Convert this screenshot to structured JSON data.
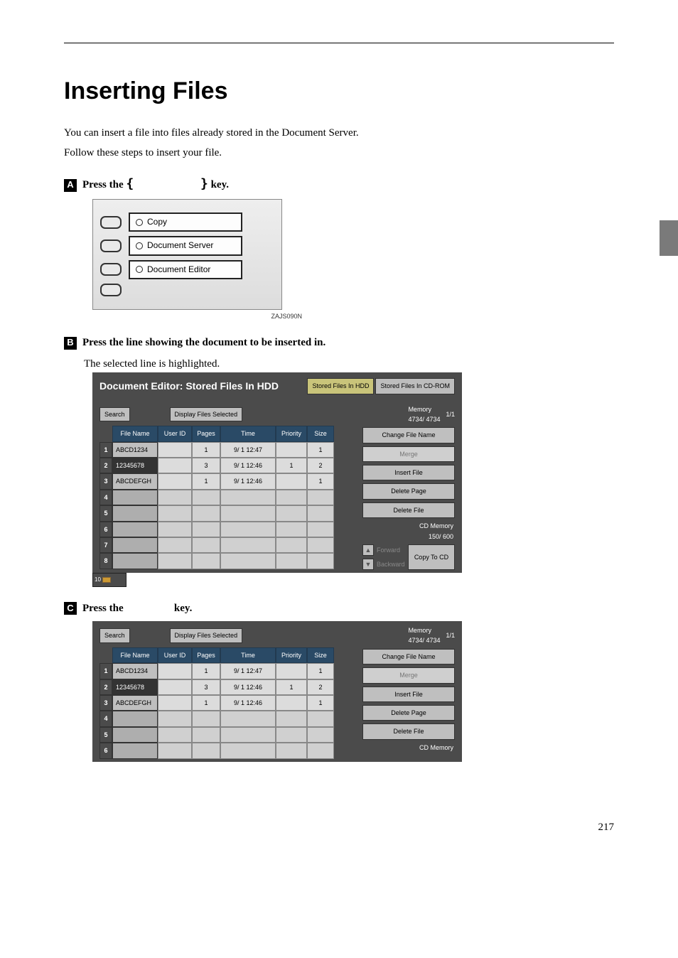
{
  "page": {
    "title": "Inserting Files",
    "intro1": "You can insert a file into files already stored in the Document Server.",
    "intro2": "Follow these steps to insert your file.",
    "number": "217"
  },
  "steps": {
    "s1": {
      "num": "1",
      "prefix": "Press the ",
      "suffix": " key."
    },
    "s2": {
      "num": "2",
      "text": "Press the line showing the document to be inserted in.",
      "sub": "The selected line is highlighted."
    },
    "s3": {
      "num": "3",
      "prefix": "Press the ",
      "suffix": " key."
    }
  },
  "modes": {
    "m1": "Copy",
    "m2": "Document Server",
    "m3": "Document Editor",
    "caption": "ZAJS090N"
  },
  "panel": {
    "title": "Document Editor: Stored Files In HDD",
    "tab_active": "Stored Files In HDD",
    "tab_inactive": "Stored Files In CD-ROM",
    "search": "Search",
    "display_sel": "Display Files Selected",
    "memory_label": "Memory",
    "memory_value": "4734/   4734",
    "page_ind": "1/1",
    "headers": {
      "file": "File Name",
      "user": "User ID",
      "pages": "Pages",
      "time": "Time",
      "priority": "Priority",
      "size": "Size"
    },
    "rows": [
      {
        "n": "1",
        "file": "ABCD1234",
        "pages": "1",
        "time": "9/  1  12:47",
        "priority": "",
        "size": "1"
      },
      {
        "n": "2",
        "file": "12345678",
        "pages": "3",
        "time": "9/  1  12:46",
        "priority": "1",
        "size": "2"
      },
      {
        "n": "3",
        "file": "ABCDEFGH",
        "pages": "1",
        "time": "9/  1  12:46",
        "priority": "",
        "size": "1"
      },
      {
        "n": "4",
        "file": "",
        "pages": "",
        "time": "",
        "priority": "",
        "size": ""
      },
      {
        "n": "5",
        "file": "",
        "pages": "",
        "time": "",
        "priority": "",
        "size": ""
      },
      {
        "n": "6",
        "file": "",
        "pages": "",
        "time": "",
        "priority": "",
        "size": ""
      },
      {
        "n": "7",
        "file": "",
        "pages": "",
        "time": "",
        "priority": "",
        "size": ""
      },
      {
        "n": "8",
        "file": "",
        "pages": "",
        "time": "",
        "priority": "",
        "size": ""
      }
    ],
    "actions": {
      "change_name": "Change File Name",
      "merge": "Merge",
      "insert": "Insert File",
      "del_page": "Delete Page",
      "del_file": "Delete File",
      "cd_mem_label": "CD Memory",
      "cd_mem_value": "150/     600",
      "forward": "Forward",
      "backward": "Backward",
      "copy_cd": "Copy To CD"
    }
  },
  "panel2": {
    "rows_visible": 6,
    "cd_mem_label": "CD Memory"
  }
}
